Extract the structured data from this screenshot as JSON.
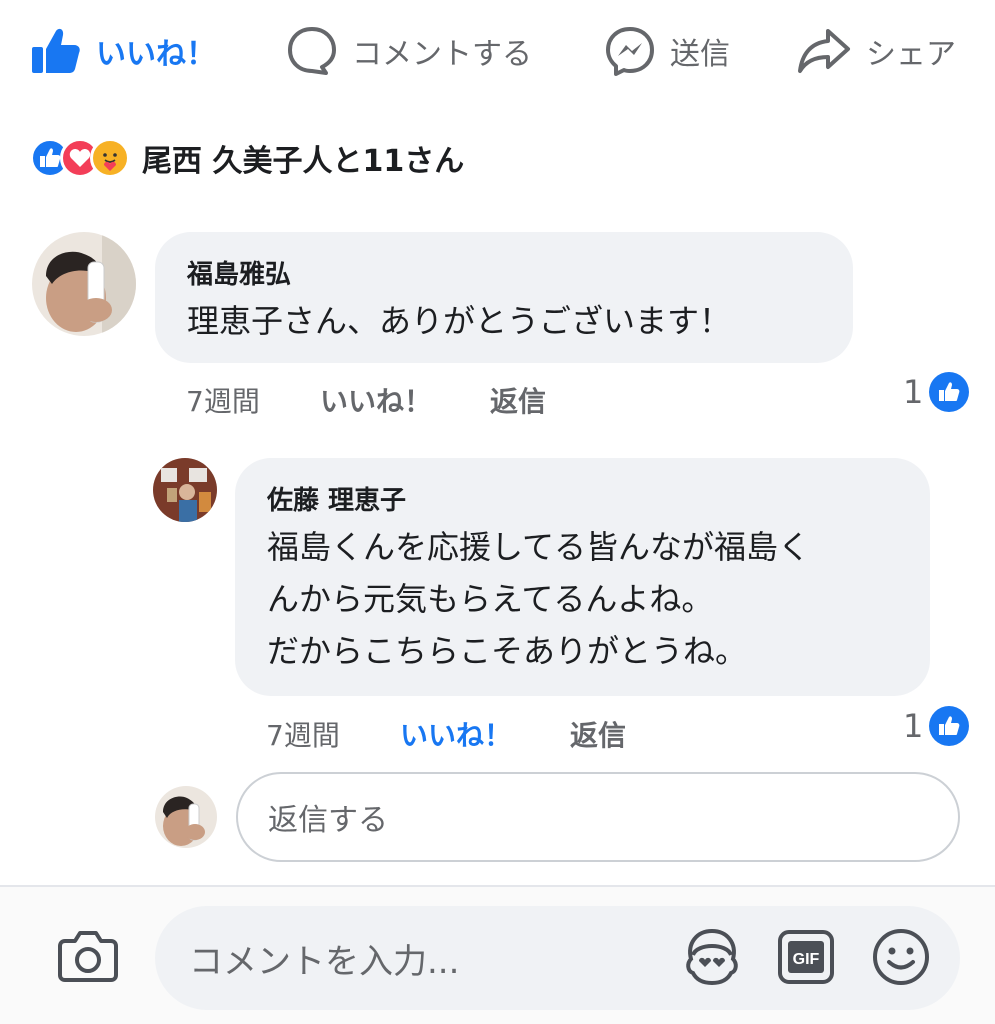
{
  "actions": {
    "like_label": "いいね！",
    "comment_label": "コメントする",
    "send_label": "送信",
    "share_label": "シェア"
  },
  "reactions": {
    "summary": "尾西 久美子人と11さん",
    "types": [
      "like-icon",
      "love-icon",
      "care-icon"
    ]
  },
  "comments": [
    {
      "author": "福島雅弘",
      "text": "理恵子さん、ありがとうございます！",
      "time": "7週間",
      "like_label": "いいね！",
      "reply_label": "返信",
      "like_count": "1"
    },
    {
      "author": "佐藤 理恵子",
      "text": "福島くんを応援してる皆んなが福島く\nんから元気もらえてるんよね。\nだからこちらこそありがとうね。",
      "time": "7週間",
      "like_label": "いいね！",
      "reply_label": "返信",
      "like_count": "1",
      "liked_by_viewer": true
    }
  ],
  "reply_box": {
    "placeholder": "返信する"
  },
  "composer": {
    "placeholder": "コメントを入力...",
    "gif_label": "GIF"
  },
  "colors": {
    "accent": "#1877f2",
    "bubble": "#f0f2f5",
    "muted_text": "#65676b"
  }
}
